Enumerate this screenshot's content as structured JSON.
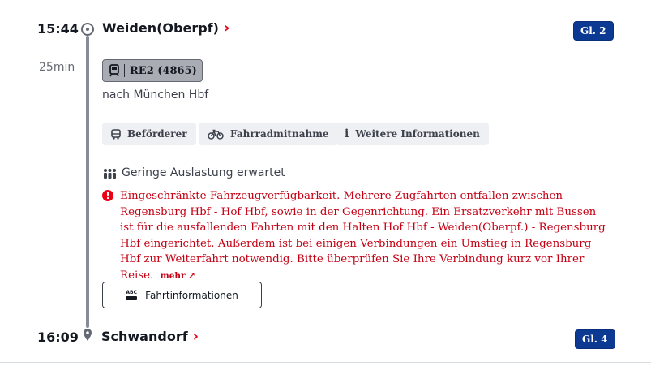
{
  "departure": {
    "time": "15:44",
    "station": "Weiden(Oberpf)",
    "platform": "Gl. 2"
  },
  "duration": "25min",
  "train": {
    "label": "RE2 (4865)",
    "direction": "nach München Hbf"
  },
  "chips": [
    {
      "label": "Beförderer",
      "icon": "bus-icon"
    },
    {
      "label": "Fahrradmitnahme",
      "icon": "bicycle-icon"
    },
    {
      "label": "Weitere Informationen",
      "icon": "info-icon"
    }
  ],
  "occupancy": "Geringe Auslastung erwartet",
  "alert": {
    "text": "Eingeschränkte Fahrzeugverfügbarkeit. Mehrere Zugfahrten entfallen zwischen Regensburg Hbf - Hof Hbf, sowie in der Gegenrichtung. Ein Ersatzverkehr mit Bussen ist für die ausfallenden Fahrten mit den Halten Hof Hbf - Weiden(Oberpf.) - Regensburg Hbf eingerichtet. Außerdem ist bei einigen Verbindungen ein Umstieg in Regensburg Hbf zur Weiterfahrt notwendig. Bitte überprüfen Sie Ihre Verbindung kurz vor Ihrer Reise.",
    "more": "mehr ↗"
  },
  "info_button": {
    "label": "Fahrtinformationen",
    "icon_text": "ABC"
  },
  "arrival": {
    "time": "16:09",
    "station": "Schwandorf",
    "platform": "Gl. 4"
  },
  "colors": {
    "accent_red": "#ec0016",
    "platform_blue": "#0c3992",
    "alert_text": "#c50014"
  }
}
